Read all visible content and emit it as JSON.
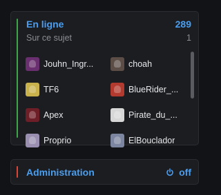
{
  "online": {
    "title": "En ligne",
    "count": "289",
    "subtitle": "Sur ce sujet",
    "subtitle_count": "1",
    "accent_color": "#3fa64b",
    "users": [
      {
        "name": "Jouhn_Ingr...",
        "avatar_color": "#6a2f6e"
      },
      {
        "name": "choah",
        "avatar_color": "#5c4e47"
      },
      {
        "name": "TF6",
        "avatar_color": "#c9b24c"
      },
      {
        "name": "BlueRider_...",
        "avatar_color": "#b23a2e"
      },
      {
        "name": "Apex",
        "avatar_color": "#6e1e26"
      },
      {
        "name": "Pirate_du_...",
        "avatar_color": "#d7d7d7"
      },
      {
        "name": "Proprio",
        "avatar_color": "#9a8fb0"
      },
      {
        "name": "ElBouclador",
        "avatar_color": "#7c86a0"
      }
    ]
  },
  "admin": {
    "title": "Administration",
    "accent_color": "#d9473a",
    "power_icon": "power-icon",
    "status": "off"
  }
}
